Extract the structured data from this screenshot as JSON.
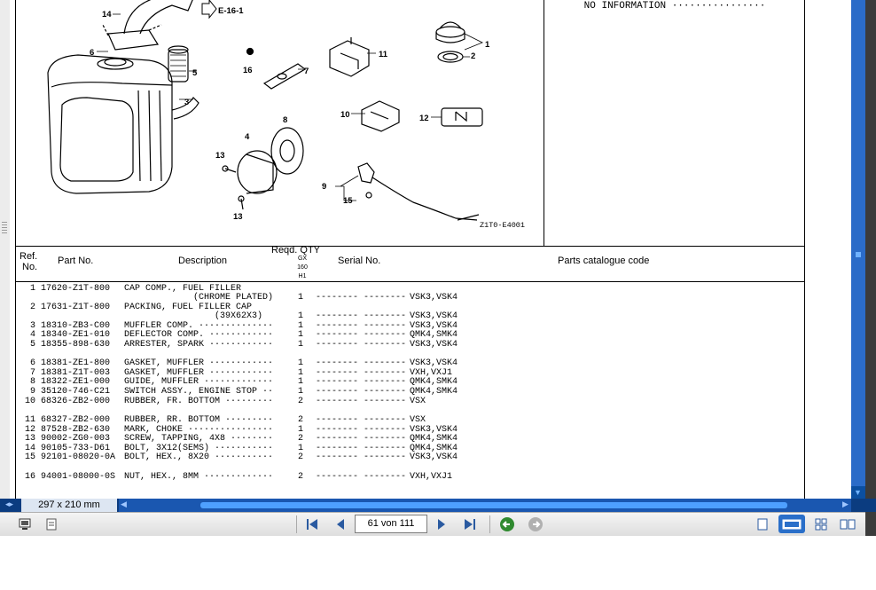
{
  "diagram": {
    "ref_link": "E-16-1",
    "drawing_code": "Z1T0-E4001",
    "callouts": [
      "1",
      "2",
      "3",
      "4",
      "5",
      "6",
      "7",
      "8",
      "9",
      "10",
      "11",
      "12",
      "13",
      "13",
      "14",
      "15",
      "16"
    ]
  },
  "info_panel": {
    "text": "NO INFORMATION ················"
  },
  "table": {
    "headers": {
      "ref_line1": "Ref.",
      "ref_line2": "No.",
      "part_no": "Part No.",
      "description": "Description",
      "reqd_qty": "Reqd. QTY",
      "qty_sub": [
        "GX",
        "160",
        "H1"
      ],
      "serial_no": "Serial No.",
      "catalogue_code": "Parts catalogue code"
    },
    "rows": [
      {
        "ref": "1",
        "part": "17620-Z1T-800",
        "desc": "CAP COMP., FUEL FILLER",
        "qty": "",
        "serial": "",
        "code": ""
      },
      {
        "ref": "",
        "part": "",
        "desc": "             (CHROME PLATED)",
        "qty": "1",
        "serial": "-------- --------",
        "code": "VSK3,VSK4"
      },
      {
        "ref": "2",
        "part": "17631-Z1T-800",
        "desc": "PACKING, FUEL FILLER CAP",
        "qty": "",
        "serial": "",
        "code": ""
      },
      {
        "ref": "",
        "part": "",
        "desc": "                 (39X62X3)",
        "qty": "1",
        "serial": "-------- --------",
        "code": "VSK3,VSK4"
      },
      {
        "ref": "3",
        "part": "18310-ZB3-C00",
        "desc": "MUFFLER COMP. ··············",
        "qty": "1",
        "serial": "-------- --------",
        "code": "VSK3,VSK4"
      },
      {
        "ref": "4",
        "part": "18340-ZE1-010",
        "desc": "DEFLECTOR COMP. ············",
        "qty": "1",
        "serial": "-------- --------",
        "code": "QMK4,SMK4"
      },
      {
        "ref": "5",
        "part": "18355-898-630",
        "desc": "ARRESTER, SPARK ············",
        "qty": "1",
        "serial": "-------- --------",
        "code": "VSK3,VSK4"
      },
      {
        "ref": "6",
        "part": "18381-ZE1-800",
        "desc": "GASKET, MUFFLER ············",
        "qty": "1",
        "serial": "-------- --------",
        "code": "VSK3,VSK4"
      },
      {
        "ref": "7",
        "part": "18381-Z1T-003",
        "desc": "GASKET, MUFFLER ············",
        "qty": "1",
        "serial": "-------- --------",
        "code": "VXH,VXJ1"
      },
      {
        "ref": "8",
        "part": "18322-ZE1-000",
        "desc": "GUIDE, MUFFLER ·············",
        "qty": "1",
        "serial": "-------- --------",
        "code": "QMK4,SMK4"
      },
      {
        "ref": "9",
        "part": "35120-746-C21",
        "desc": "SWITCH ASSY., ENGINE STOP ··",
        "qty": "1",
        "serial": "-------- --------",
        "code": "QMK4,SMK4"
      },
      {
        "ref": "10",
        "part": "68326-ZB2-000",
        "desc": "RUBBER, FR. BOTTOM ·········",
        "qty": "2",
        "serial": "-------- --------",
        "code": "VSX"
      },
      {
        "ref": "11",
        "part": "68327-ZB2-000",
        "desc": "RUBBER, RR. BOTTOM ·········",
        "qty": "2",
        "serial": "-------- --------",
        "code": "VSX"
      },
      {
        "ref": "12",
        "part": "87528-ZB2-630",
        "desc": "MARK, CHOKE ················",
        "qty": "1",
        "serial": "-------- --------",
        "code": "VSK3,VSK4"
      },
      {
        "ref": "13",
        "part": "90002-ZG0-003",
        "desc": "SCREW, TAPPING, 4X8 ········",
        "qty": "2",
        "serial": "-------- --------",
        "code": "QMK4,SMK4"
      },
      {
        "ref": "14",
        "part": "90105-733-D61",
        "desc": "BOLT, 3X12(SEMS) ···········",
        "qty": "1",
        "serial": "-------- --------",
        "code": "QMK4,SMK4"
      },
      {
        "ref": "15",
        "part": "92101-08020-0A",
        "desc": "BOLT, HEX., 8X20 ···········",
        "qty": "2",
        "serial": "-------- --------",
        "code": "VSK3,VSK4"
      },
      {
        "ref": "16",
        "part": "94001-08000-0S",
        "desc": "NUT, HEX., 8MM ·············",
        "qty": "2",
        "serial": "-------- --------",
        "code": "VXH,VXJ1"
      }
    ]
  },
  "statusbar": {
    "page_size": "297 x 210 mm"
  },
  "navigation": {
    "page_indicator": "61 von 111"
  },
  "icons": {
    "first_page": "first-page-icon",
    "prev_page": "prev-page-icon",
    "next_page": "next-page-icon",
    "last_page": "last-page-icon",
    "go_back": "go-back-icon",
    "go_forward": "go-forward-icon",
    "view_single": "single-page-view-icon",
    "view_fit": "fit-width-view-icon",
    "view_grid": "grid-view-icon",
    "view_double": "double-page-view-icon"
  },
  "colors": {
    "scroll_blue": "#1a57b0",
    "scroll_thumb": "#4ea0ff",
    "go_green": "#2f8a2f"
  }
}
